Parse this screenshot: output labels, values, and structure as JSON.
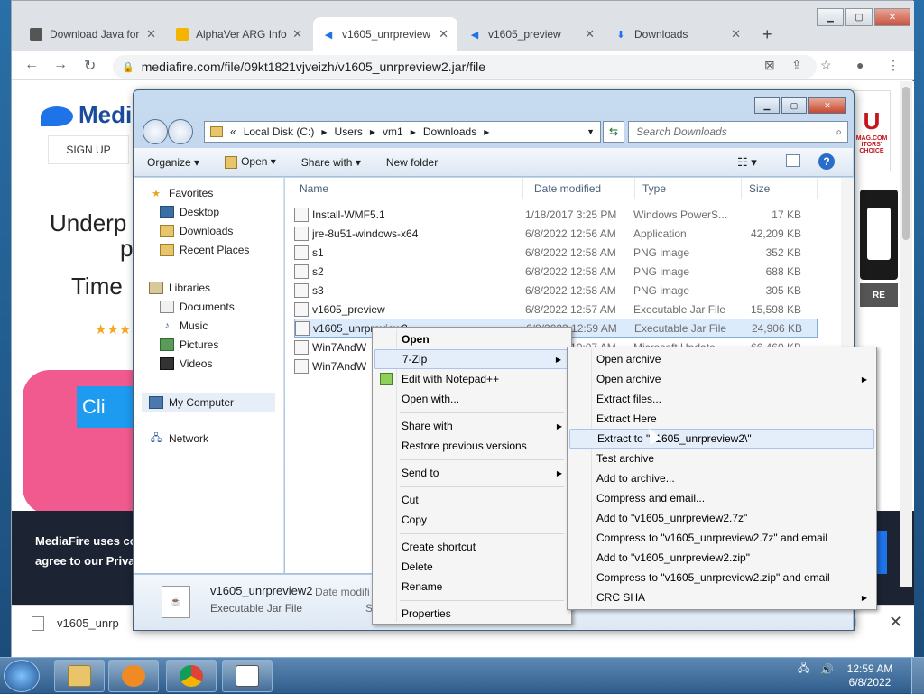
{
  "browser": {
    "tabs": [
      {
        "title": "Download Java for",
        "favicon": "java-icon",
        "active": false
      },
      {
        "title": "AlphaVer ARG Info",
        "favicon": "doc-icon",
        "active": false
      },
      {
        "title": "v1605_unrpreview",
        "favicon": "mediafire-icon",
        "active": true
      },
      {
        "title": "v1605_preview",
        "favicon": "mediafire-icon",
        "active": false
      },
      {
        "title": "Downloads",
        "favicon": "download-icon",
        "active": false
      }
    ],
    "new_tab": "+",
    "url": "mediafire.com/file/09kt1821vjveizh/v1605_unrpreview2.jar/file"
  },
  "mediafire_page": {
    "brand": "Medi",
    "signup": "SIGN UP",
    "hero_line1": "Underp",
    "hero_line2": "p",
    "hero_line3": "Time",
    "stars": "★★★",
    "click_btn": "Cli",
    "cookie_line1": "MediaFire uses co",
    "cookie_line2": "agree to our Privac",
    "ad_text": "U",
    "ad_sub": "ITORS' CHOICE",
    "ad_sub2": "MAG.COM",
    "gray_pane_text": "RE",
    "download_name": "v1605_unrp",
    "show_all": "all"
  },
  "explorer": {
    "breadcrumbs": [
      "Local Disk (C:)",
      "Users",
      "vm1",
      "Downloads"
    ],
    "breadcrumb_prefix": "«",
    "search_placeholder": "Search Downloads",
    "commands": {
      "organize": "Organize",
      "open": "Open",
      "share_with": "Share with",
      "new_folder": "New folder"
    },
    "nav": {
      "favorites": "Favorites",
      "desktop": "Desktop",
      "downloads": "Downloads",
      "recent": "Recent Places",
      "libraries": "Libraries",
      "documents": "Documents",
      "music": "Music",
      "pictures": "Pictures",
      "videos": "Videos",
      "computer": "My Computer",
      "network": "Network"
    },
    "columns": {
      "name": "Name",
      "date": "Date modified",
      "type": "Type",
      "size": "Size"
    },
    "files": [
      {
        "name": "Install-WMF5.1",
        "date": "1/18/2017 3:25 PM",
        "type": "Windows PowerS...",
        "size": "17 KB",
        "icon": "powershell-icon"
      },
      {
        "name": "jre-8u51-windows-x64",
        "date": "6/8/2022 12:56 AM",
        "type": "Application",
        "size": "42,209 KB",
        "icon": "java-installer-icon"
      },
      {
        "name": "s1",
        "date": "6/8/2022 12:58 AM",
        "type": "PNG image",
        "size": "352 KB",
        "icon": "image-icon"
      },
      {
        "name": "s2",
        "date": "6/8/2022 12:58 AM",
        "type": "PNG image",
        "size": "688 KB",
        "icon": "image-icon"
      },
      {
        "name": "s3",
        "date": "6/8/2022 12:58 AM",
        "type": "PNG image",
        "size": "305 KB",
        "icon": "image-icon"
      },
      {
        "name": "v1605_preview",
        "date": "6/8/2022 12:57 AM",
        "type": "Executable Jar File",
        "size": "15,598 KB",
        "icon": "jar-icon"
      },
      {
        "name": "v1605_unrpreview2",
        "date": "6/8/2022 12:59 AM",
        "type": "Executable Jar File",
        "size": "24,906 KB",
        "icon": "jar-icon",
        "selected": true
      },
      {
        "name": "Win7AndW",
        "date": "6/7/2022 10:07 AM",
        "type": "Microsoft Update",
        "size": "66,460 KB",
        "icon": "update-icon"
      },
      {
        "name": "Win7AndW",
        "date": "",
        "type": "",
        "size": "",
        "icon": "zip-icon"
      }
    ],
    "details": {
      "name": "v1605_unrpreview2",
      "type": "Executable Jar File",
      "date_label": "Date modifi",
      "size_label": "Si"
    }
  },
  "context_menu": {
    "items": [
      {
        "label": "Open",
        "bold": true
      },
      {
        "label": "7-Zip",
        "submenu": true,
        "highlight": true
      },
      {
        "label": "Edit with Notepad++",
        "icon": "notepadpp-icon"
      },
      {
        "label": "Open with..."
      },
      {
        "sep": true
      },
      {
        "label": "Share with",
        "submenu": true
      },
      {
        "label": "Restore previous versions"
      },
      {
        "sep": true
      },
      {
        "label": "Send to",
        "submenu": true
      },
      {
        "sep": true
      },
      {
        "label": "Cut"
      },
      {
        "label": "Copy"
      },
      {
        "sep": true
      },
      {
        "label": "Create shortcut"
      },
      {
        "label": "Delete"
      },
      {
        "label": "Rename"
      },
      {
        "sep": true
      },
      {
        "label": "Properties"
      }
    ]
  },
  "sevenzip_menu": {
    "items": [
      {
        "label": "Open archive"
      },
      {
        "label": "Open archive",
        "submenu": true
      },
      {
        "label": "Extract files..."
      },
      {
        "label": "Extract Here"
      },
      {
        "label": "Extract to \"v1605_unrpreview2\\\"",
        "highlight": true
      },
      {
        "label": "Test archive"
      },
      {
        "label": "Add to archive..."
      },
      {
        "label": "Compress and email..."
      },
      {
        "label": "Add to \"v1605_unrpreview2.7z\""
      },
      {
        "label": "Compress to \"v1605_unrpreview2.7z\" and email"
      },
      {
        "label": "Add to \"v1605_unrpreview2.zip\""
      },
      {
        "label": "Compress to \"v1605_unrpreview2.zip\" and email"
      },
      {
        "label": "CRC SHA",
        "submenu": true
      }
    ]
  },
  "taskbar": {
    "apps": [
      "explorer-icon",
      "media-player-icon",
      "chrome-icon",
      "solitaire-icon"
    ],
    "time": "12:59 AM",
    "date": "6/8/2022"
  },
  "colors": {
    "accent": "#1e73e8",
    "taskbar": "#2f5d8c",
    "selection": "#dcebfc"
  }
}
